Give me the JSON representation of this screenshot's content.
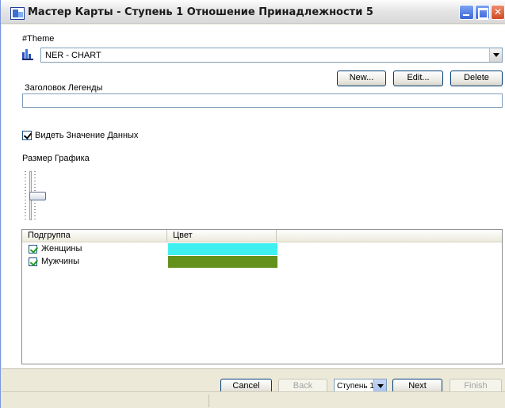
{
  "window": {
    "title": "Мастер Карты  - Ступень 1 Отношение Принадлежности  5"
  },
  "theme": {
    "label": "#Theme",
    "selected": "NER - CHART",
    "icon": "bar-chart-icon"
  },
  "buttons": {
    "new": "New...",
    "edit": "Edit...",
    "delete": "Delete"
  },
  "legend_title": {
    "label": "Заголовок Легенды",
    "value": ""
  },
  "show_values": {
    "label": "Видеть Значение Данных",
    "checked": true
  },
  "chart_size": {
    "label": "Размер Графика"
  },
  "grid": {
    "columns": [
      "Подгруппа",
      "Цвет"
    ],
    "rows": [
      {
        "name": "Женщины",
        "checked": true,
        "color": "#40f0f0"
      },
      {
        "name": "Мужчины",
        "checked": true,
        "color": "#64901c"
      }
    ]
  },
  "footer": {
    "cancel": "Cancel",
    "back": "Back",
    "step": "Ступень 1",
    "next": "Next",
    "finish": "Finish"
  }
}
